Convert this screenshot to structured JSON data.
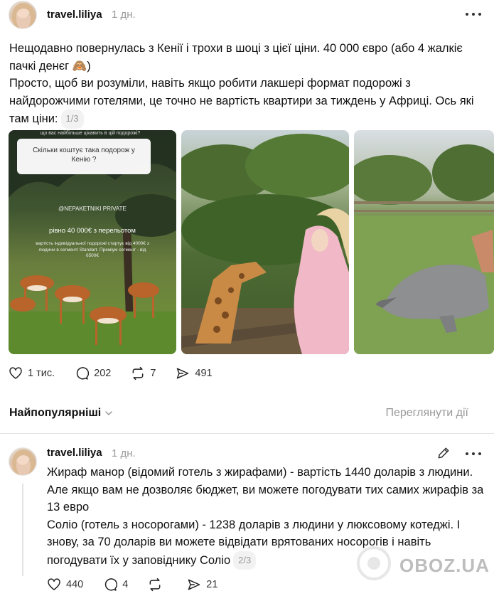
{
  "post": {
    "username": "travel.liliya",
    "time": "1 дн.",
    "text_lines": [
      "Нещодавно повернулась з Кенії і трохи в шоці з цієї ціни. 40 000 євро (або 4 жалкіє пачкі денєг 🙈)",
      "Просто, щоб ви розуміли, навіть якщо робити лакшері формат подорожі з найдорожчими готелями, це точно не вартість квартири за тиждень у Африці. Ось які там ціни:"
    ],
    "pager": "1/3",
    "images": [
      {
        "question_top": "що вас найбільше цікавить в цій подорожі?",
        "question": "Скільки коштує така подорож у Кенію ?",
        "brand": "@NEPAKETNIKI PRIVATE",
        "price": "рівно 40 000€ з перельотом",
        "details": "вартість індивідуальної подорожі стартує від 4000€ з людини в сегменті Standart. Преміум сегмент - від 6500€"
      },
      {
        "alt": "giraffe"
      },
      {
        "alt": "rhino"
      }
    ],
    "stats": {
      "likes": "1 тис.",
      "comments": "202",
      "reposts": "7",
      "shares": "491"
    }
  },
  "sort": {
    "label": "Найпопулярніші",
    "view_activity": "Переглянути дії"
  },
  "reply": {
    "username": "travel.liliya",
    "time": "1 дн.",
    "text_lines": [
      "Жираф манор (відомий готель з жирафами) - вартість 1440 доларів з людини. Але якщо вам не дозволяє бюджет, ви можете погодувати тих самих жирафів за 13 евро",
      "Соліо (готель з носорогами) - 1238 доларів з людини у люксовому котеджі. І знову, за 70 доларів ви можете відвідати врятованих носорогів і навіть погодувати їх у заповіднику Соліо"
    ],
    "pager": "2/3",
    "stats": {
      "likes": "440",
      "comments": "4",
      "reposts": "",
      "shares": "21"
    }
  },
  "watermark": "OBOZ.UA"
}
